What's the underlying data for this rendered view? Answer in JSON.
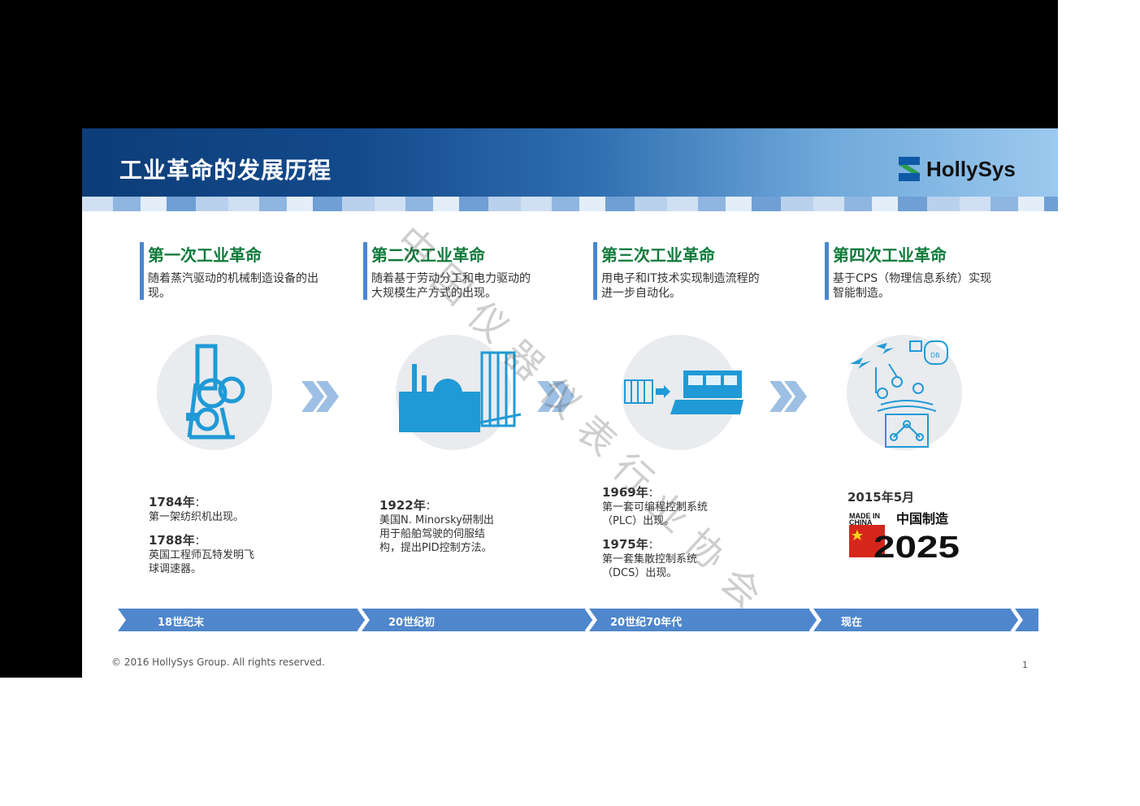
{
  "header": {
    "title": "工业革命的发展历程",
    "brand": "HollySys"
  },
  "revolutions": [
    {
      "title": "第一次工业革命",
      "desc": "随着蒸汽驱动的机械制造设备的出现。",
      "entries": [
        {
          "year": "1784年",
          "sep": "：",
          "text": "第一架纺织机出现。"
        },
        {
          "year": "1788年",
          "sep": "：",
          "text": "英国工程师瓦特发明飞球调速器。"
        }
      ]
    },
    {
      "title": "第二次工业革命",
      "desc": "随着基于劳动分工和电力驱动的大规模生产方式的出现。",
      "entries": [
        {
          "year": "1922年",
          "sep": "：",
          "text": "美国N. Minorsky研制出用于船舶驾驶的伺服结构，提出PID控制方法。"
        }
      ]
    },
    {
      "title": "第三次工业革命",
      "desc": "用电子和IT技术实现制造流程的进一步自动化。",
      "entries": [
        {
          "year": "1969年",
          "sep": "：",
          "text": "第一套可编程控制系统（PLC）出现。"
        },
        {
          "year": "1975年",
          "sep": "：",
          "text": "第一套集散控制系统（DCS）出现。"
        }
      ]
    },
    {
      "title": "第四次工业革命",
      "desc": "基于CPS（物理信息系统）实现智能制造。",
      "entries": [
        {
          "year": "2015年5月",
          "sep": "",
          "text": ""
        }
      ]
    }
  ],
  "badge": {
    "made_in": "MADE IN",
    "china": "CHINA",
    "cn": "中国制造",
    "year": "2025"
  },
  "icon_labels": {
    "db": "DB"
  },
  "timeline": [
    "18世纪末",
    "20世纪初",
    "20世纪70年代",
    "现在"
  ],
  "footer": {
    "copyright": "© 2016 HollySys Group. All rights reserved.",
    "page": "1"
  },
  "watermark": "中国仪器仪表行业协会",
  "colors": {
    "accent_blue": "#4a86cf",
    "title_green": "#0f7a3a",
    "icon_blue": "#1f9ad6",
    "timeline_blue": "#4f86cc"
  }
}
